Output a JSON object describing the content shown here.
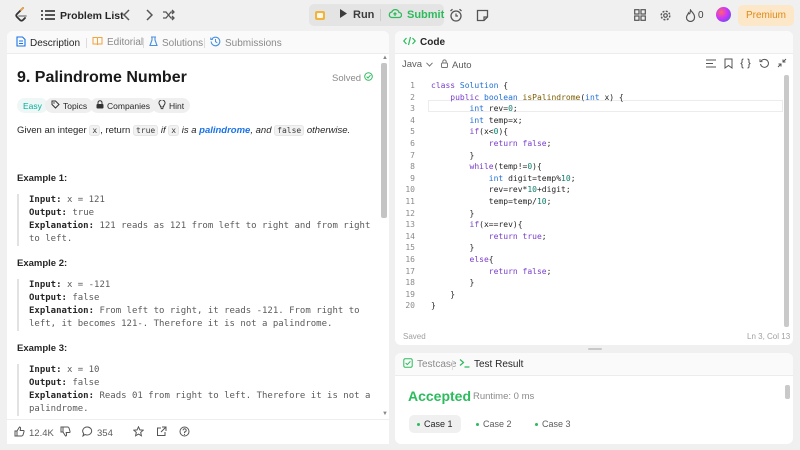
{
  "topbar": {
    "problem_list_label": "Problem List",
    "run_label": "Run",
    "submit_label": "Submit",
    "streak_count": "0",
    "premium_label": "Premium"
  },
  "colors": {
    "accent_green": "#2cbb5d",
    "premium_orange": "#e08a16",
    "link_blue": "#1a73e8"
  },
  "left_panel": {
    "tabs": [
      {
        "label": "Description",
        "icon": "document-icon"
      },
      {
        "label": "Editorial",
        "icon": "book-icon"
      },
      {
        "label": "Solutions",
        "icon": "flask-icon"
      },
      {
        "label": "Submissions",
        "icon": "history-icon"
      }
    ],
    "title": "9. Palindrome Number",
    "status": "Solved",
    "chips": {
      "difficulty": "Easy",
      "topics": "Topics",
      "companies": "Companies",
      "hint": "Hint"
    },
    "description": {
      "p1": "Given an integer",
      "c1": "x",
      "p2": ", return",
      "c2": "true",
      "p3": "if",
      "c3": "x",
      "p4": "is a",
      "link": "palindrome",
      "p5": ", and",
      "c4": "false",
      "p6": "otherwise."
    },
    "examples": [
      {
        "title": "Example 1:",
        "input_label": "Input:",
        "input": "x = 121",
        "output_label": "Output:",
        "output": "true",
        "explanation_label": "Explanation:",
        "explanation_l1": "121 reads as 121 from left to right and from right",
        "explanation_l2": "to left."
      },
      {
        "title": "Example 2:",
        "input_label": "Input:",
        "input": "x = -121",
        "output_label": "Output:",
        "output": "false",
        "explanation_label": "Explanation:",
        "explanation_l1": "From left to right, it reads -121. From right to",
        "explanation_l2": "left, it becomes 121-. Therefore it is not a palindrome."
      },
      {
        "title": "Example 3:",
        "input_label": "Input:",
        "input": "x = 10",
        "output_label": "Output:",
        "output": "false",
        "explanation_label": "Explanation:",
        "explanation_l1": "Reads 01 from right to left. Therefore it is not a",
        "explanation_l2": "palindrome."
      }
    ],
    "footer": {
      "likes": "12.4K",
      "comments": "354"
    }
  },
  "code_panel": {
    "tab_label": "Code",
    "language": "Java",
    "auto_label": "Auto",
    "status": "Saved",
    "cursor": "Ln 3, Col 13",
    "line_numbers": [
      "1",
      "2",
      "3",
      "4",
      "5",
      "6",
      "7",
      "8",
      "9",
      "10",
      "11",
      "12",
      "13",
      "14",
      "15",
      "16",
      "17",
      "18",
      "19",
      "20"
    ]
  },
  "result_panel": {
    "testcase_tab": "Testcase",
    "result_tab": "Test Result",
    "verdict": "Accepted",
    "runtime": "Runtime: 0 ms",
    "cases": [
      "Case 1",
      "Case 2",
      "Case 3"
    ]
  }
}
